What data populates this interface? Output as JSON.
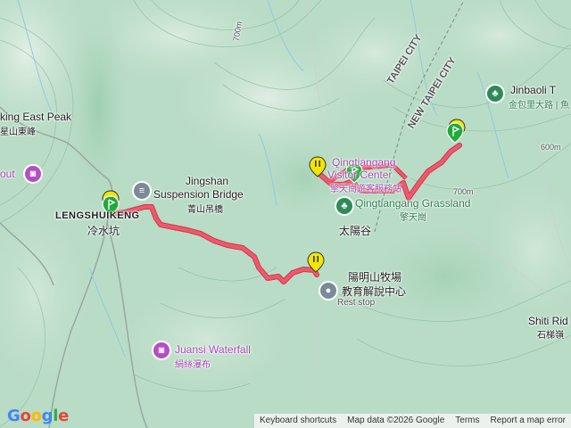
{
  "map": {
    "places": {
      "lengshuikeng_en": "LENGSHUIKENG",
      "lengshuikeng_zh": "冷水坑",
      "jingshan_en_1": "Jingshan",
      "jingshan_en_2": "Suspension Bridge",
      "jingshan_zh": "菁山吊橋",
      "qingtiangang_vc_en_1": "Qingtiangang",
      "qingtiangang_vc_en_2": "Visitor Center",
      "qingtiangang_vc_zh": "擎天崗遊客服務站",
      "grassland_en": "Qingtiangang Grassland",
      "grassland_zh": "擎天崗",
      "taiyanggu": "太陽谷",
      "ranch_zh_1": "陽明山牧場",
      "ranch_zh_2": "教育解說中心",
      "rest_stop": "Rest stop",
      "juansi_en": "Juansi Waterfall",
      "juansi_zh": "絹絲瀑布",
      "east_peak_en": "king East Peak",
      "east_peak_zh": "星山東峰",
      "lookout": "out",
      "jinbaoli_en": "Jinbaoli T",
      "jinbaoli_zh": "金包里大路 | 魚",
      "taipei_city": "TAIPEI CITY",
      "new_taipei_city": "NEW TAIPEI CITY",
      "shiti_en": "Shiti Rid",
      "shiti_zh": "石梯嶺",
      "contour_700": "700m",
      "contour_600": "600m",
      "contour_700b": "700m"
    },
    "footer": {
      "shortcuts": "Keyboard shortcuts",
      "map_data": "Map data ©2026 Google",
      "terms": "Terms",
      "report": "Report a map error"
    },
    "logo": "Google",
    "colors": {
      "route": "#f0586b",
      "route_outline": "#c9394d",
      "terrain": "#b9dcc6",
      "marker_yellow": "#f2e600",
      "marker_green": "#1faa39"
    }
  }
}
